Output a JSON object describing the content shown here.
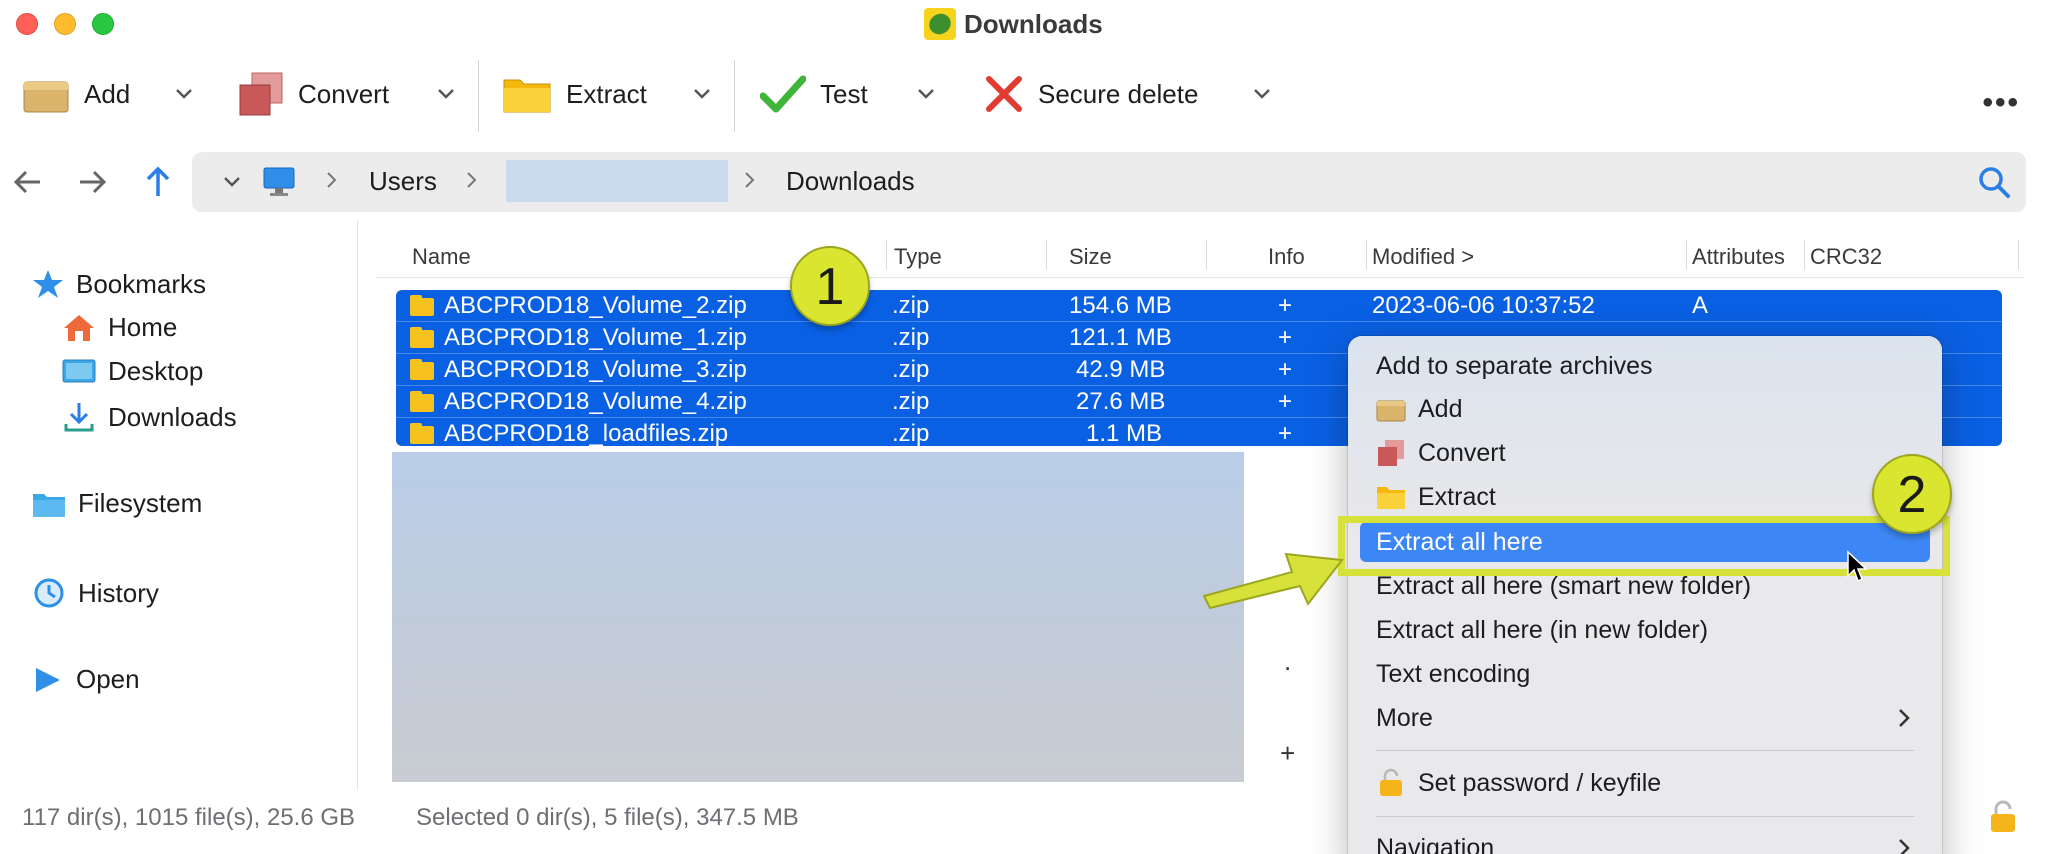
{
  "window": {
    "title": "Downloads"
  },
  "toolbar": {
    "add": "Add",
    "convert": "Convert",
    "extract": "Extract",
    "test": "Test",
    "secure_delete": "Secure delete",
    "more": "•••"
  },
  "pathbar": {
    "users": "Users",
    "downloads": "Downloads"
  },
  "sidebar": {
    "bookmarks": "Bookmarks",
    "home": "Home",
    "desktop": "Desktop",
    "downloads": "Downloads",
    "filesystem": "Filesystem",
    "history": "History",
    "open": "Open"
  },
  "columns": {
    "name": "Name",
    "type": "Type",
    "size": "Size",
    "info": "Info",
    "modified": "Modified >",
    "attributes": "Attributes",
    "crc32": "CRC32"
  },
  "files": [
    {
      "name": "ABCPROD18_Volume_2.zip",
      "type": ".zip",
      "size": "154.6 MB",
      "info": "+",
      "modified": "2023-06-06 10:37:52",
      "attr": "A"
    },
    {
      "name": "ABCPROD18_Volume_1.zip",
      "type": ".zip",
      "size": "121.1 MB",
      "info": "+",
      "modified": "",
      "attr": ""
    },
    {
      "name": "ABCPROD18_Volume_3.zip",
      "type": ".zip",
      "size": "42.9 MB",
      "info": "+",
      "modified": "",
      "attr": ""
    },
    {
      "name": "ABCPROD18_Volume_4.zip",
      "type": ".zip",
      "size": "27.6 MB",
      "info": "+",
      "modified": "",
      "attr": ""
    },
    {
      "name": "ABCPROD18_loadfiles.zip",
      "type": ".zip",
      "size": "1.1 MB",
      "info": "+",
      "modified": "",
      "attr": ""
    }
  ],
  "list_extras": {
    "dot": ".",
    "plus": "+"
  },
  "context_menu": {
    "add_separate": "Add to separate archives",
    "add": "Add",
    "convert": "Convert",
    "extract": "Extract",
    "extract_all_here": "Extract all here",
    "extract_smart": "Extract all here (smart new folder)",
    "extract_new": "Extract all here (in new folder)",
    "text_encoding": "Text encoding",
    "more": "More",
    "set_password": "Set password / keyfile",
    "navigation": "Navigation"
  },
  "status": {
    "totals": "117 dir(s), 1015 file(s), 25.6 GB",
    "selected": "Selected 0 dir(s), 5 file(s), 347.5 MB"
  },
  "annotations": {
    "badge1": "1",
    "badge2": "2"
  },
  "colors": {
    "selection": "#0a60e3",
    "highlight": "#3d86f5",
    "annotation": "#d9e52e"
  }
}
